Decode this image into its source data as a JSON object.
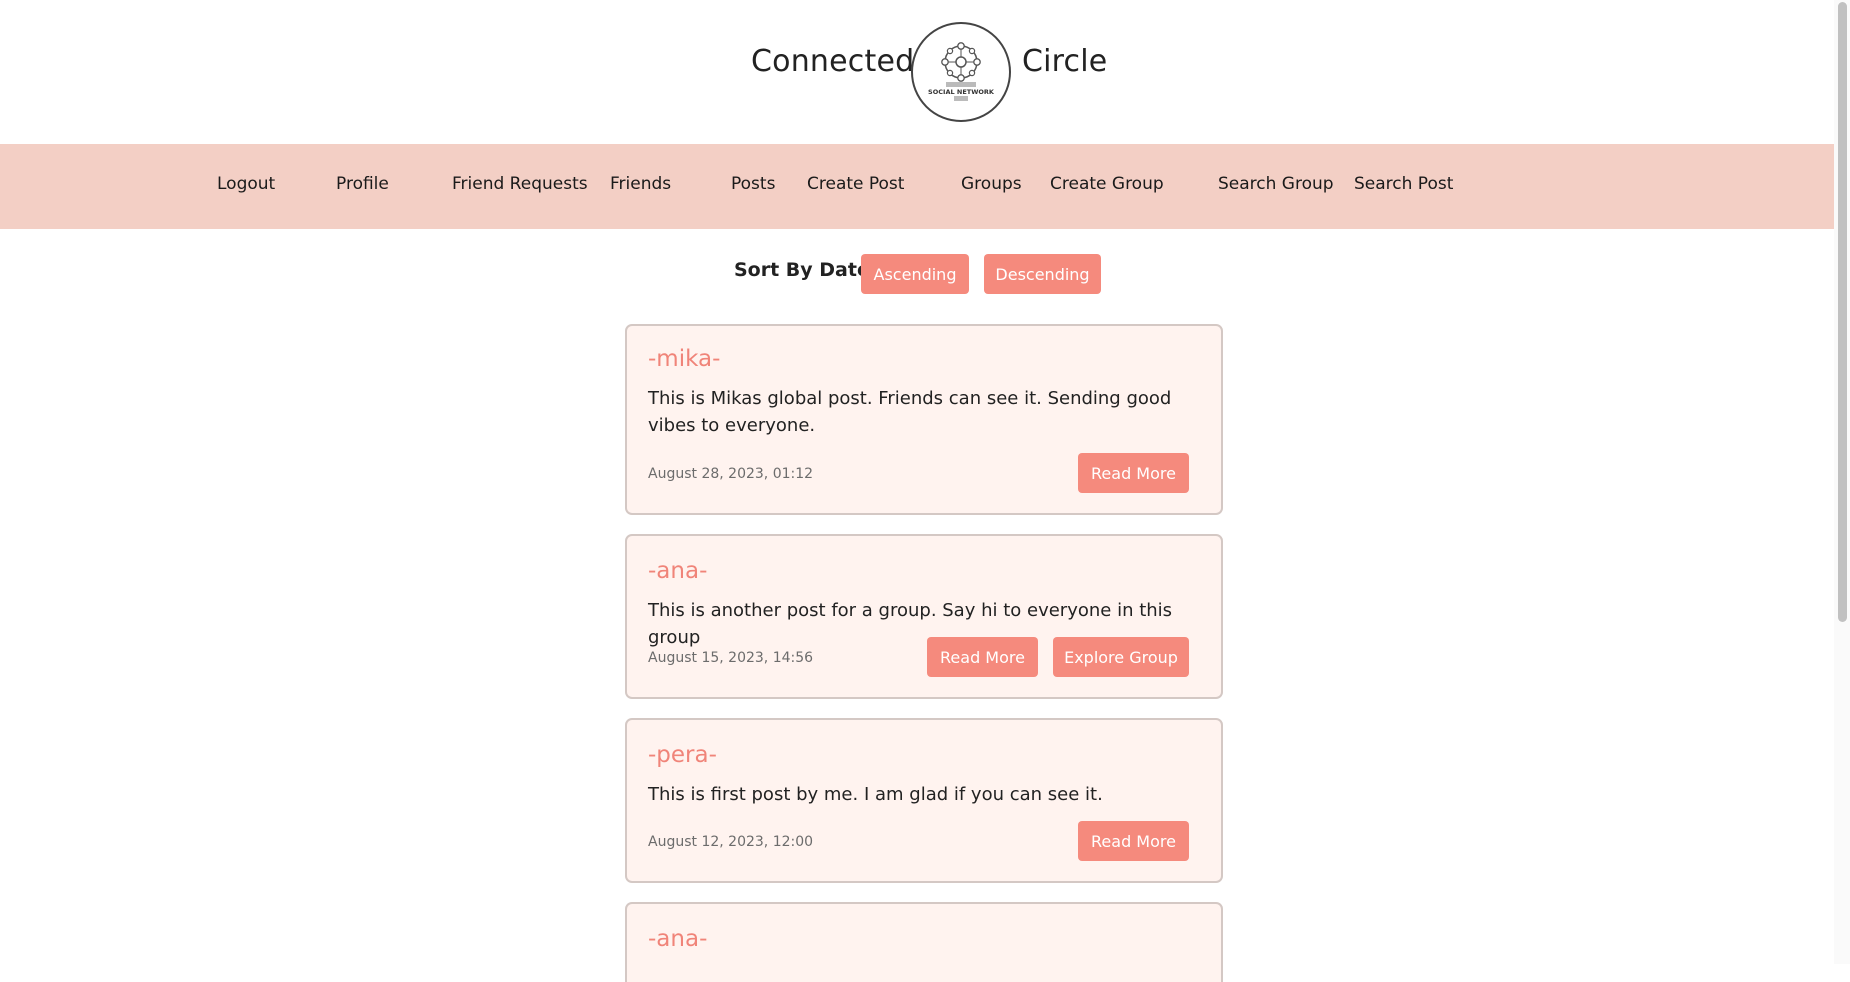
{
  "brand": {
    "left_word": "Connected",
    "right_word": "Circle",
    "logo_caption": "SOCIAL NETWORK"
  },
  "nav": {
    "items": [
      {
        "label": "Logout"
      },
      {
        "label": "Profile"
      },
      {
        "label": "Friend Requests"
      },
      {
        "label": "Friends"
      },
      {
        "label": "Posts"
      },
      {
        "label": "Create Post"
      },
      {
        "label": "Groups"
      },
      {
        "label": "Create Group"
      },
      {
        "label": "Search Group"
      },
      {
        "label": "Search Post"
      }
    ]
  },
  "sort": {
    "label": "Sort By Date:",
    "ascending_label": "Ascending",
    "descending_label": "Descending"
  },
  "posts": [
    {
      "author": "-mika-",
      "content": "This is Mikas global post. Friends can see it. Sending good vibes to everyone.",
      "date": "August 28, 2023, 01:12",
      "read_more_label": "Read More"
    },
    {
      "author": "-ana-",
      "content": "This is another post for a group. Say hi to everyone in this group",
      "date": "August 15, 2023, 14:56",
      "read_more_label": "Read More",
      "explore_group_label": "Explore Group"
    },
    {
      "author": "-pera-",
      "content": "This is first post by me. I am glad if you can see it.",
      "date": "August 12, 2023, 12:00",
      "read_more_label": "Read More"
    },
    {
      "author": "-ana-"
    }
  ],
  "colors": {
    "accent": "#f58a7d",
    "nav_background": "#f3cfc5",
    "card_background": "#fff3ef",
    "author": "#f08479"
  }
}
